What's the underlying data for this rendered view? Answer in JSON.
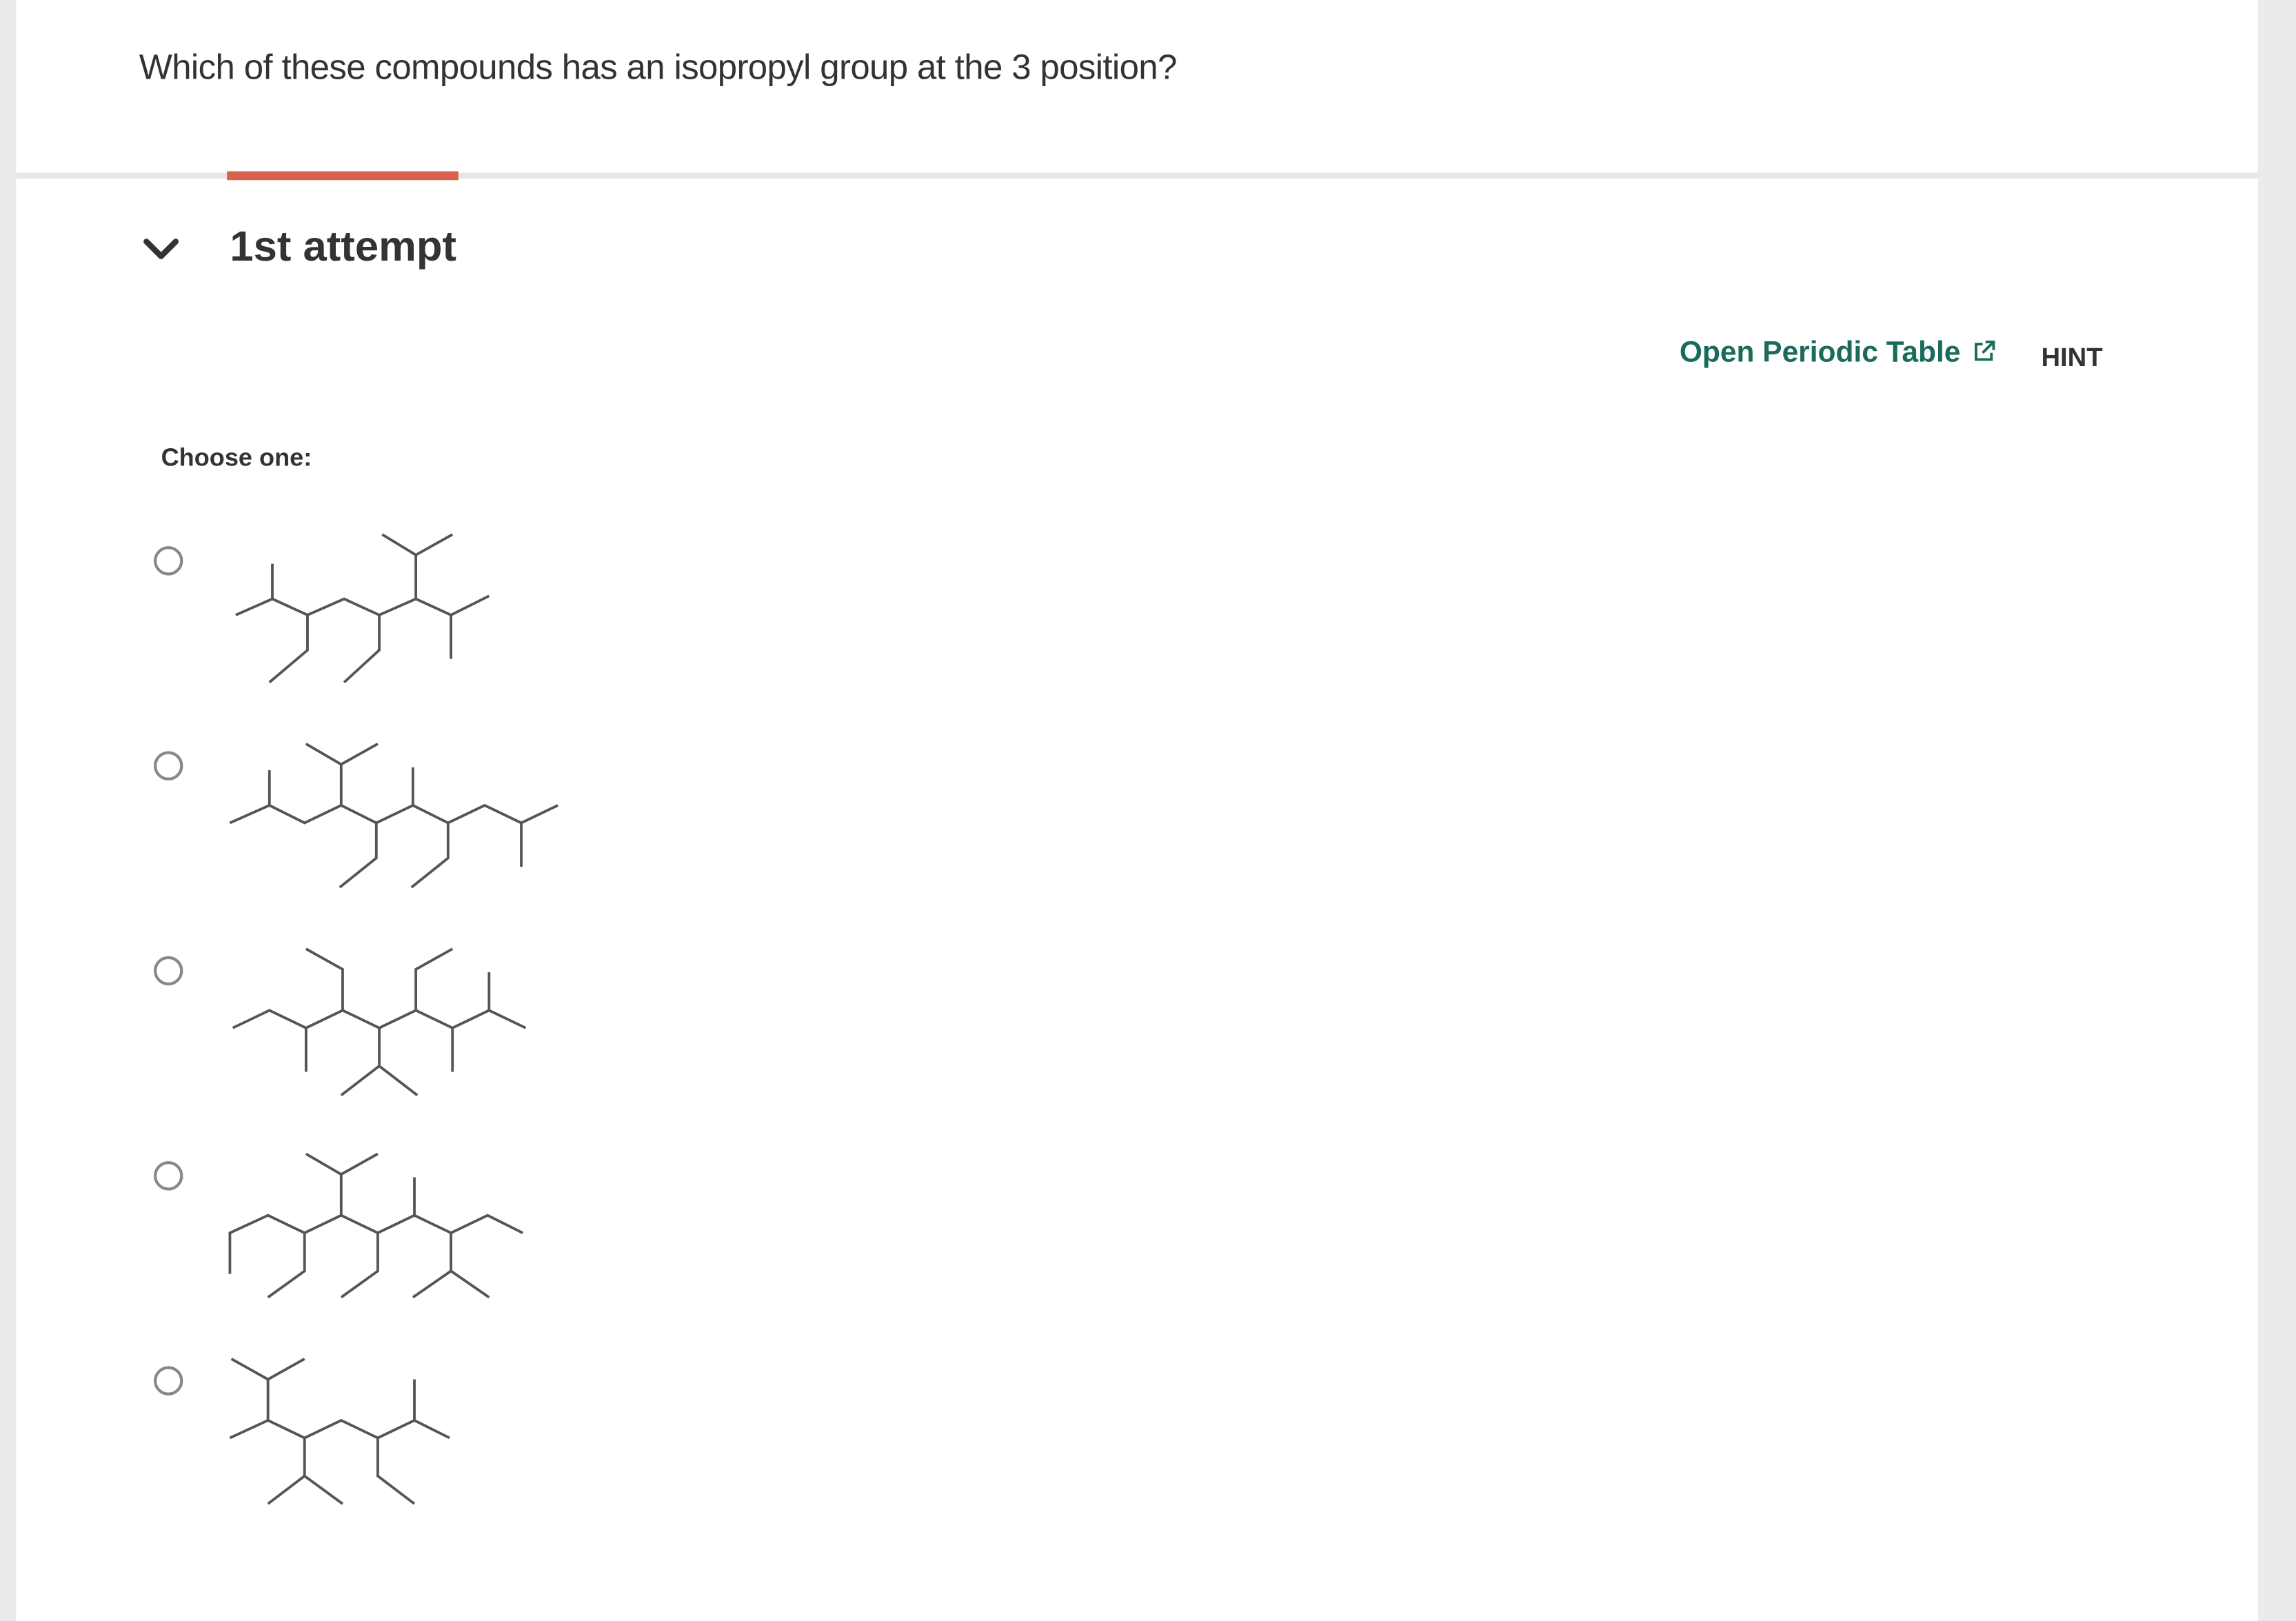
{
  "question": {
    "text": "Which of these compounds has an isopropyl group at the 3 position?"
  },
  "attempt": {
    "label": "1st attempt",
    "expanded_icon": "chevron-down-icon"
  },
  "toolbar": {
    "periodic_table_label": "Open Periodic Table",
    "periodic_table_icon": "external-link-icon",
    "hint_label": "HINT"
  },
  "choices": {
    "prompt": "Choose one:",
    "options": [
      {
        "selected": false,
        "image": "skeletal-structure-1"
      },
      {
        "selected": false,
        "image": "skeletal-structure-2"
      },
      {
        "selected": false,
        "image": "skeletal-structure-3"
      },
      {
        "selected": false,
        "image": "skeletal-structure-4"
      },
      {
        "selected": false,
        "image": "skeletal-structure-5"
      }
    ]
  },
  "colors": {
    "accent_tab": "#d9604a",
    "link": "#1a6b5a",
    "text": "#333333"
  }
}
